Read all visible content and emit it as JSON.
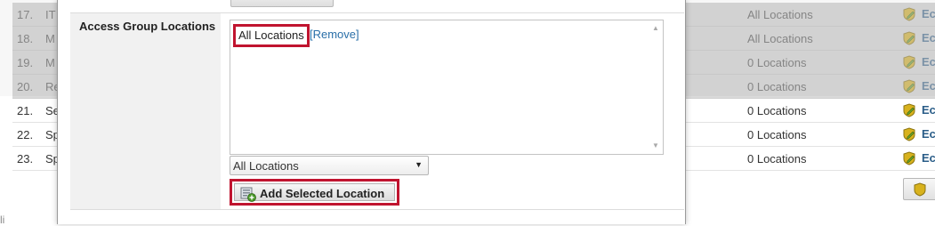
{
  "background_table": {
    "rows": [
      {
        "num": "17.",
        "name": "IT",
        "locations": "All Locations",
        "edit": "Ec",
        "dimmed": true
      },
      {
        "num": "18.",
        "name": "M",
        "locations": "All Locations",
        "edit": "Ec",
        "dimmed": true
      },
      {
        "num": "19.",
        "name": "M",
        "locations": "0 Locations",
        "edit": "Ec",
        "dimmed": true
      },
      {
        "num": "20.",
        "name": "Re",
        "locations": "0 Locations",
        "edit": "Ec",
        "dimmed": true
      },
      {
        "num": "21.",
        "name": "Se",
        "locations": "0 Locations",
        "edit": "Ec",
        "dimmed": false
      },
      {
        "num": "22.",
        "name": "Sp",
        "locations": "0 Locations",
        "edit": "Ec",
        "dimmed": false
      },
      {
        "num": "23.",
        "name": "Sp",
        "locations": "0 Locations",
        "edit": "Ec",
        "dimmed": false
      }
    ],
    "bottom_text": "li"
  },
  "dialog": {
    "field_label": "Access Group Locations",
    "selected_locations": [
      {
        "label": "All Locations",
        "remove_label": "[Remove]"
      }
    ],
    "location_select": {
      "selected": "All Locations"
    },
    "add_button_label": "Add Selected Location"
  },
  "colors": {
    "highlight": "#c0142f",
    "link": "#2a6fa8",
    "edit_link": "#2a5d88",
    "dim_row": "#d9d9d9"
  },
  "icons": {
    "edit": "edit-pencil-shield-icon",
    "add": "add-location-icon",
    "select_caret": "chevron-down-icon",
    "scroll_up": "scroll-up-arrow-icon",
    "scroll_down": "scroll-down-arrow-icon"
  }
}
